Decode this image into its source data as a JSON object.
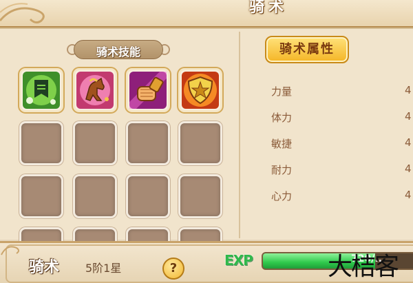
{
  "window": {
    "title": "骑术"
  },
  "skills_panel": {
    "title": "骑术技能",
    "slots": [
      {
        "state": "filled",
        "icon": "green-banner-skill-icon"
      },
      {
        "state": "filled",
        "icon": "horse-skill-icon"
      },
      {
        "state": "filled",
        "icon": "fist-skill-icon"
      },
      {
        "state": "filled",
        "icon": "shield-skill-icon"
      },
      {
        "state": "empty"
      },
      {
        "state": "empty"
      },
      {
        "state": "empty"
      },
      {
        "state": "empty"
      },
      {
        "state": "empty"
      },
      {
        "state": "empty"
      },
      {
        "state": "empty"
      },
      {
        "state": "empty"
      },
      {
        "state": "empty"
      },
      {
        "state": "empty"
      },
      {
        "state": "empty"
      },
      {
        "state": "empty"
      }
    ]
  },
  "attributes_panel": {
    "title": "骑术属性",
    "rows": [
      {
        "label": "力量",
        "value": "4"
      },
      {
        "label": "体力",
        "value": "4"
      },
      {
        "label": "敏捷",
        "value": "4"
      },
      {
        "label": "耐力",
        "value": "4"
      },
      {
        "label": "心力",
        "value": "4"
      }
    ]
  },
  "footer": {
    "skill_name": "骑术",
    "rank": "5阶1星",
    "help_label": "?",
    "exp_label": "EXP",
    "exp_fraction": 0.72,
    "exp_text": "720/..."
  },
  "watermark": "大桔客",
  "colors": {
    "accent_gold": "#f4b526",
    "exp_green": "#2fc94c",
    "panel_bg": "#f1e4cc"
  }
}
